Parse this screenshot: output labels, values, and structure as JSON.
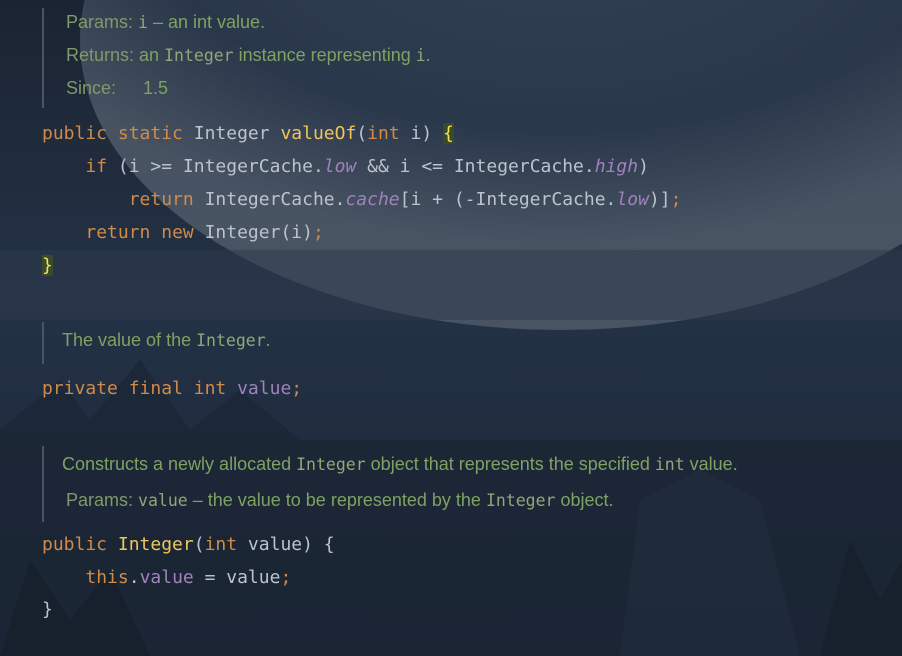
{
  "doc1": {
    "params_label": "Params:",
    "params_name": "i",
    "params_desc": " – an int value.",
    "returns_label": "Returns:",
    "returns_pre": "an ",
    "returns_type": "Integer",
    "returns_post": " instance representing ",
    "returns_var": "i",
    "returns_end": ".",
    "since_label": "Since:",
    "since_value": "1.5"
  },
  "method_valueof": {
    "line1": {
      "kw1": "public",
      "kw2": "static",
      "type": "Integer",
      "name": "valueOf",
      "params_open": "(",
      "ptype": "int",
      "pname": " i) ",
      "brace": "{"
    },
    "line2": {
      "kw": "if",
      "a": " (i >= IntegerCache.",
      "low": "low",
      "b": " && i <= IntegerCache.",
      "high": "high",
      "c": ")"
    },
    "line3": {
      "kw": "return",
      "a": " IntegerCache.",
      "cache": "cache",
      "b": "[i + (-IntegerCache.",
      "low": "low",
      "c": ")]",
      "semi": ";"
    },
    "line4": {
      "kw": "return",
      "kw2": "new",
      "a": " Integer(i)",
      "semi": ";"
    },
    "line5": {
      "brace": "}"
    }
  },
  "doc2": {
    "pre": "The value of the ",
    "type": "Integer",
    "post": "."
  },
  "field_value": {
    "kw1": "private",
    "kw2": "final",
    "type": "int",
    "name": "value",
    "semi": ";"
  },
  "doc3": {
    "l1_pre": "Constructs a newly allocated ",
    "l1_type": "Integer",
    "l1_mid": " object that represents the specified ",
    "l1_int": "int",
    "l1_post": " value.",
    "params_label": "Params:",
    "params_name": "value",
    "params_desc": " – the value to be represented by the ",
    "params_type": "Integer",
    "params_end": " object."
  },
  "constructor": {
    "line1": {
      "kw": "public",
      "name": "Integer",
      "open": "(",
      "ptype": "int",
      "rest": " value) {"
    },
    "line2": {
      "kw": "this",
      "dot": ".",
      "field": "value",
      "rest": " = value",
      "semi": ";"
    },
    "line3": {
      "brace": "}"
    }
  },
  "colors": {
    "keyword": "#d08b49",
    "method": "#f2c55c",
    "field": "#a082bd",
    "doc": "#7ea262",
    "text": "#bcc3cc"
  }
}
